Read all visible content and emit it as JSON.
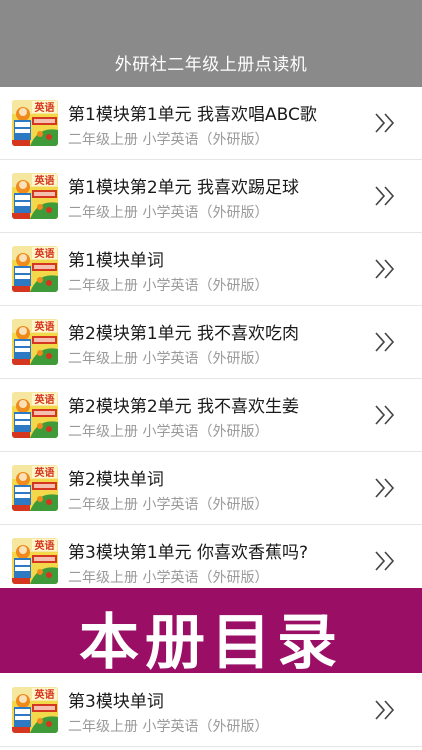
{
  "nav": {
    "title": "外研社二年级上册点读机"
  },
  "thumb": {
    "icon": "textbook-cover-icon",
    "title": "英语",
    "colors": {
      "bg": "#f2d84a",
      "red": "#d4361f",
      "green": "#3f9b3a",
      "blue": "#2e79c4",
      "orange": "#f08a1c"
    }
  },
  "items": [
    {
      "title": "第1模块第1单元 我喜欢唱ABC歌",
      "subtitle": "二年级上册 小学英语（外研版）"
    },
    {
      "title": "第1模块第2单元 我喜欢踢足球",
      "subtitle": "二年级上册 小学英语（外研版）"
    },
    {
      "title": "第1模块单词",
      "subtitle": "二年级上册 小学英语（外研版）"
    },
    {
      "title": "第2模块第1单元 我不喜欢吃肉",
      "subtitle": "二年级上册 小学英语（外研版）"
    },
    {
      "title": "第2模块第2单元 我不喜欢生姜",
      "subtitle": "二年级上册 小学英语（外研版）"
    },
    {
      "title": "第2模块单词",
      "subtitle": "二年级上册 小学英语（外研版）"
    },
    {
      "title": "第3模块第1单元 你喜欢香蕉吗?",
      "subtitle": "二年级上册 小学英语（外研版）"
    }
  ],
  "banner": {
    "text": "本册目录",
    "color": "#9b0e66"
  },
  "items_after": [
    {
      "title": "第3模块单词",
      "subtitle": "二年级上册 小学英语（外研版）"
    }
  ],
  "chevron_icon": "double-chevron-right-icon"
}
